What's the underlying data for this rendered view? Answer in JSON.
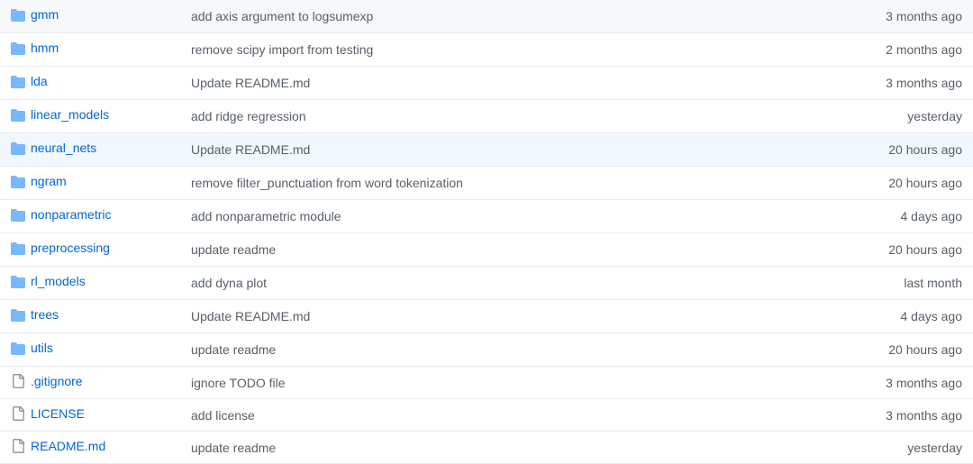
{
  "files": [
    {
      "type": "folder",
      "name": "gmm",
      "message": "add axis argument to logsumexp",
      "time": "3 months ago"
    },
    {
      "type": "folder",
      "name": "hmm",
      "message": "remove scipy import from testing",
      "time": "2 months ago"
    },
    {
      "type": "folder",
      "name": "lda",
      "message": "Update README.md",
      "time": "3 months ago"
    },
    {
      "type": "folder",
      "name": "linear_models",
      "message": "add ridge regression",
      "time": "yesterday"
    },
    {
      "type": "folder",
      "name": "neural_nets",
      "message": "Update README.md",
      "time": "20 hours ago",
      "highlighted": true
    },
    {
      "type": "folder",
      "name": "ngram",
      "message": "remove filter_punctuation from word tokenization",
      "time": "20 hours ago"
    },
    {
      "type": "folder",
      "name": "nonparametric",
      "message": "add nonparametric module",
      "time": "4 days ago"
    },
    {
      "type": "folder",
      "name": "preprocessing",
      "message": "update readme",
      "time": "20 hours ago"
    },
    {
      "type": "folder",
      "name": "rl_models",
      "message": "add dyna plot",
      "time": "last month"
    },
    {
      "type": "folder",
      "name": "trees",
      "message": "Update README.md",
      "time": "4 days ago"
    },
    {
      "type": "folder",
      "name": "utils",
      "message": "update readme",
      "time": "20 hours ago"
    },
    {
      "type": "file",
      "name": ".gitignore",
      "message": "ignore TODO file",
      "time": "3 months ago"
    },
    {
      "type": "file",
      "name": "LICENSE",
      "message": "add license",
      "time": "3 months ago"
    },
    {
      "type": "file",
      "name": "README.md",
      "message": "update readme",
      "time": "yesterday"
    }
  ]
}
